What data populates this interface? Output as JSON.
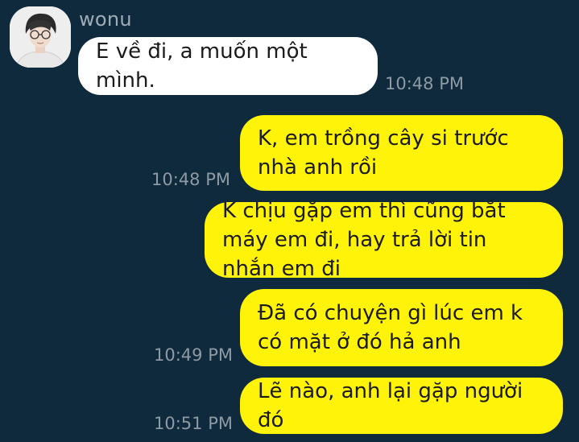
{
  "contact": {
    "name": "wonu",
    "avatar_icon": "profile-photo"
  },
  "messages": [
    {
      "direction": "incoming",
      "text": "E về đi, a muốn một mình.",
      "time": "10:48 PM"
    },
    {
      "direction": "outgoing",
      "text": "K, em trồng cây si trước nhà anh rồi",
      "time": "10:48 PM"
    },
    {
      "direction": "outgoing",
      "text": "K chịu gặp em thì cũng bắt máy em đi, hay trả lời tin nhắn em đi",
      "time": ""
    },
    {
      "direction": "outgoing",
      "text": "Đã có chuyện gì lúc em k có mặt ở đó hả anh",
      "time": "10:49 PM"
    },
    {
      "direction": "outgoing",
      "text": "Lẽ nào, anh lại gặp người đó",
      "time": "10:51 PM"
    }
  ],
  "colors": {
    "background": "#0f2a3d",
    "incoming_bubble": "#ffffff",
    "outgoing_bubble": "#fff30a",
    "timestamp": "#8d9aa4",
    "sender_name": "#9eadb8"
  }
}
